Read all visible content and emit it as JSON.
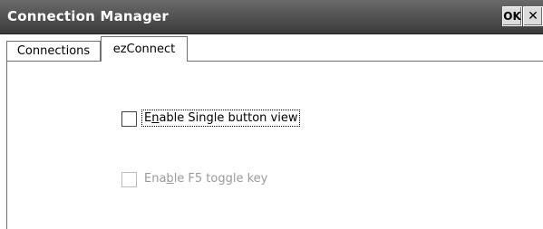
{
  "window": {
    "title": "Connection Manager",
    "ok_label": "OK",
    "close_label": "✕"
  },
  "tabs": [
    {
      "label": "Connections",
      "selected": false
    },
    {
      "label": "ezConnect",
      "selected": true
    }
  ],
  "options": {
    "single_button": {
      "pre": "E",
      "accel": "n",
      "post": "able Single button view",
      "checked": false,
      "enabled": true
    },
    "f5_toggle": {
      "pre": "Ena",
      "accel": "b",
      "post": "le F5 toggle key",
      "checked": false,
      "enabled": false
    }
  }
}
